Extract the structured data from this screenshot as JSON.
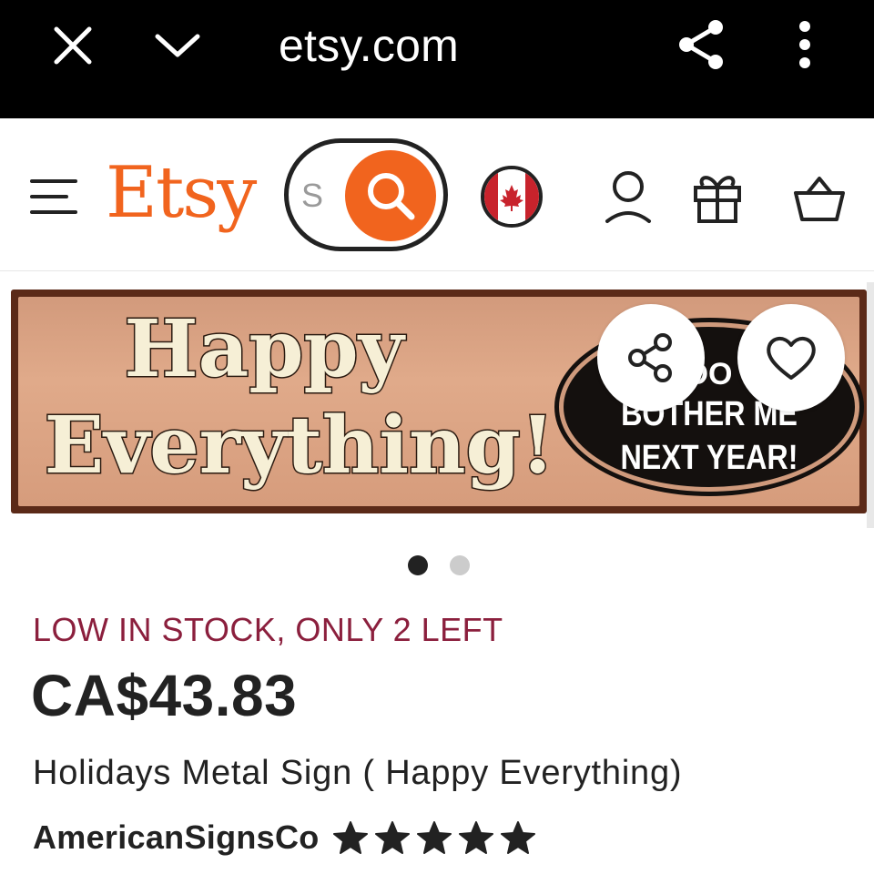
{
  "browser": {
    "url": "etsy.com",
    "icons": [
      "close-icon",
      "chevron-down-icon",
      "share-icon",
      "more-vertical-icon"
    ]
  },
  "header": {
    "logo": "Etsy",
    "search_placeholder": "S",
    "region_flag": "canada-flag",
    "icons": [
      "menu-icon",
      "search-icon",
      "account-icon",
      "gift-icon",
      "basket-icon"
    ],
    "accent_color": "#F1641E"
  },
  "product": {
    "image": {
      "sign_text_line1": "Happy",
      "sign_text_line2": "Everything!",
      "oval_line1": "DO",
      "oval_line2": "BOTHER ME",
      "oval_line3": "NEXT YEAR!"
    },
    "image_pager": {
      "count": 2,
      "active_index": 0
    },
    "stock_notice": "LOW IN STOCK, ONLY 2 LEFT",
    "price": "CA$43.83",
    "title": "Holidays Metal Sign ( Happy Everything)",
    "shop_name": "AmericanSignsCo",
    "rating": {
      "stars": 5,
      "max": 5
    },
    "stock_color": "#8b1f3d"
  }
}
